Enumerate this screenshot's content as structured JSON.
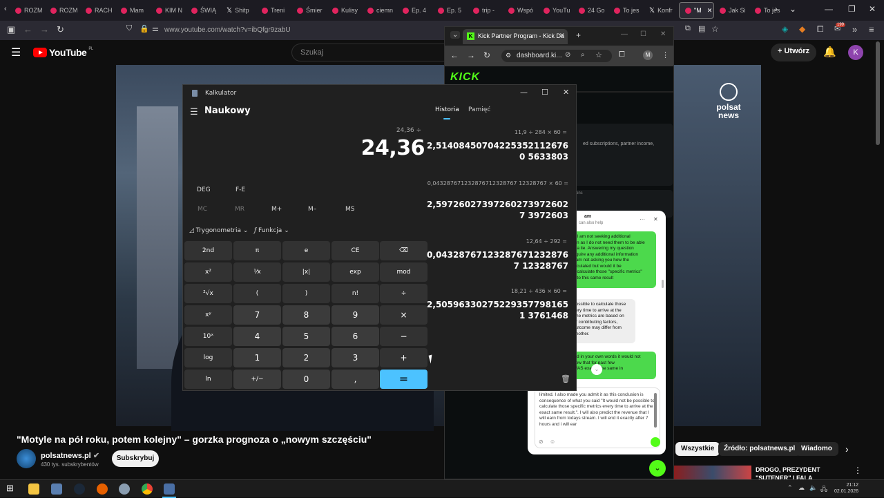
{
  "browser": {
    "tabs": [
      "ROZM",
      "ROZM",
      "RACH",
      "Mam",
      "KIM N",
      "ŚWIĄ",
      "Shitp",
      "Treni",
      "Śmier",
      "Kulisy",
      "ciemn",
      "Ep. 4",
      "Ep. 5",
      "trip -",
      "Wspó",
      "YouTu",
      "24 Go",
      "To jes",
      "Konfr",
      "\"M",
      "Jak Si",
      "To jes"
    ],
    "url": "www.youtube.com/watch?v=ibQfgr9zabU",
    "badge_count": "199"
  },
  "youtube": {
    "logo_text": "YouTube",
    "region": "PL",
    "search_placeholder": "Szukaj",
    "create_label": "Utwórz",
    "avatar_letter": "K",
    "video_title": "\"Motyle na pół roku, potem kolejny\" – gorzka prognoza o „nowym szczęściu\"",
    "channel_name": "polsatnews.pl",
    "subscribers": "430 tys. subskrybentów",
    "subscribe_label": "Subskrybuj",
    "chips": [
      "Wszystkie",
      "Źródło: polsatnews.pl",
      "Wiadomo"
    ],
    "side_video_title": "DROGO, PREZYDENT \"SUTENER\" I FALA UKRAIŃCÓ",
    "overlay_brand_1": "polsat",
    "overlay_brand_2": "news"
  },
  "kick": {
    "tab_title": "Kick Partner Program - Kick Da",
    "url": "dashboard.ki...",
    "logo": "KICK",
    "snippet": "ed subscriptions, partner income,",
    "snippet2": "ons",
    "chat_header": "am",
    "chat_subheader": "can also help",
    "msg1": "o I am not seeking additional\nion as I do not need them to be able\ne a lie. Answering my question\nequire any additional information\nI am not asking you how the\nalculated but would it be\no calculate those \"specific metrics\"\ne to this same result",
    "msg2": "possible to calculate those\nvery time to arrive at the\nThe metrics are based on\ner contributing factors,\noutcome may differ from\nanother.",
    "msg3": "aid in your own words it would not\nhow       that for past few\nWAS      exactly the same in",
    "input_text": "limited. I also made you admit it as this conclusion is consequence of what you said \"It would not be possible to calculate those specific metrics every time to arrive at the exact same result.\".  I will also predict the revenue that I will earn from todays stream. I will end it exactly after 7 hours and i will ear"
  },
  "calculator": {
    "window_title": "Kalkulator",
    "mode_title": "Naukowy",
    "expression": "24,36 ÷",
    "display": "24,36",
    "angle_mode": "DEG",
    "fe_label": "F-E",
    "memory_buttons": [
      "MC",
      "MR",
      "M+",
      "M–",
      "MS"
    ],
    "trig_label": "Trygonometria",
    "func_label": "Funkcja",
    "keys": [
      [
        "2nd",
        "π",
        "e",
        "CE",
        "⌫"
      ],
      [
        "x²",
        "¹⁄x",
        "|x|",
        "exp",
        "mod"
      ],
      [
        "²√x",
        "(",
        ")",
        "n!",
        "÷"
      ],
      [
        "xʸ",
        "7",
        "8",
        "9",
        "×"
      ],
      [
        "10ˣ",
        "4",
        "5",
        "6",
        "−"
      ],
      [
        "log",
        "1",
        "2",
        "3",
        "+"
      ],
      [
        "ln",
        "+/−",
        "0",
        ",",
        "="
      ]
    ],
    "history_tab": "Historia",
    "memory_tab": "Pamięć",
    "history": [
      {
        "expr": "11,9  ÷  284  ×  60 =",
        "result": "2,514084507042253521126760 5633803"
      },
      {
        "expr": "0,043287671232876712328767 12328767  ×  60 =",
        "result": "2,597260273972602739726027 3972603"
      },
      {
        "expr": "12,64  ÷  292 =",
        "result": "0,043287671232876712328767 12328767"
      },
      {
        "expr": "18,21  ÷  436  ×  60 =",
        "result": "2,505963302752293577981651 3761468"
      }
    ]
  },
  "taskbar": {
    "time": "21:12",
    "date": "02.01.2026"
  }
}
